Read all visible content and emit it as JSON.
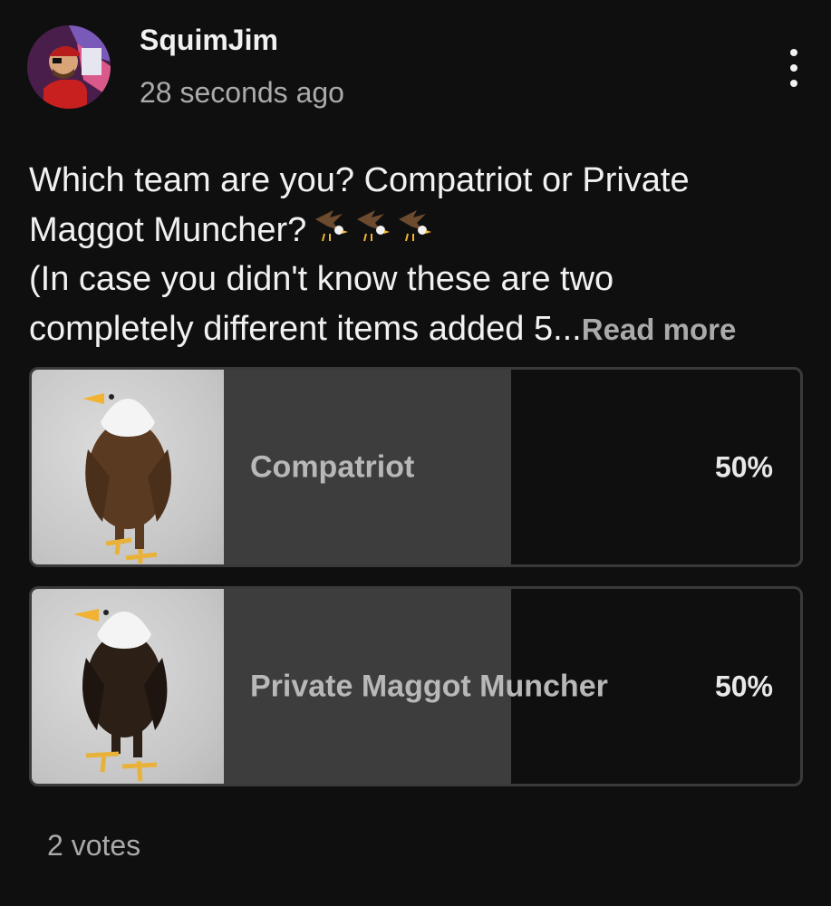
{
  "author": {
    "name": "SquimJim",
    "timestamp": "28 seconds ago"
  },
  "post": {
    "text_line1": "Which team are you? Compatriot or Private",
    "text_line2": "Maggot Muncher?",
    "emojis": [
      "eagle-emoji",
      "eagle-emoji",
      "eagle-emoji"
    ],
    "text_line3": "(In case you didn't know these are two",
    "text_line4": "completely different items added 5...",
    "read_more": "Read more"
  },
  "poll": {
    "options": [
      {
        "label": "Compatriot",
        "percent": "50%",
        "fraction": 0.5,
        "image": "bald-eagle-standing"
      },
      {
        "label": "Private Maggot Muncher",
        "percent": "50%",
        "fraction": 0.5,
        "image": "bald-eagle-standing"
      }
    ],
    "votes": "2 votes"
  },
  "colors": {
    "background": "#0f0f0f",
    "fill": "#3d3d3d",
    "border": "#3a3a3a",
    "secondary_text": "#aaaaaa"
  }
}
